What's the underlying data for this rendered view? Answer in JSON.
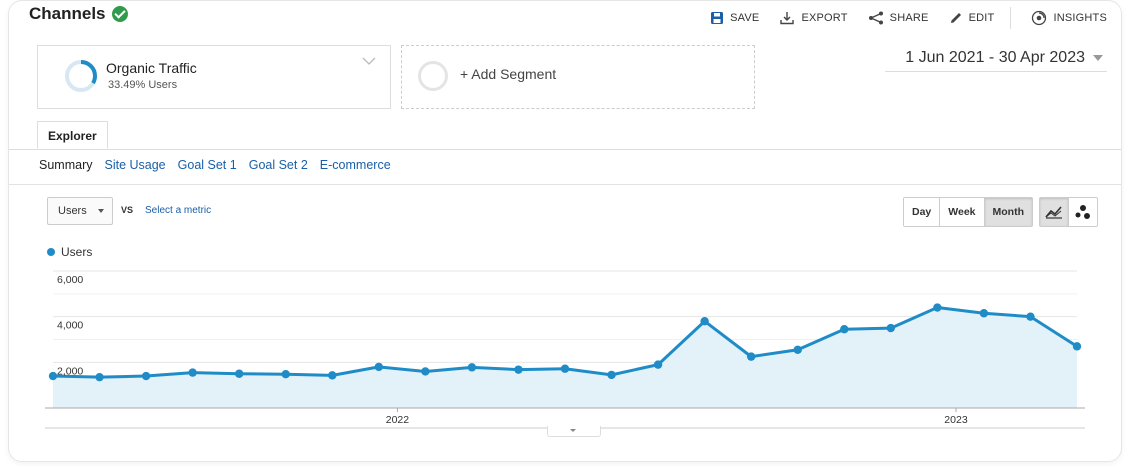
{
  "header": {
    "title": "Channels",
    "toolbar": {
      "save": "SAVE",
      "export": "EXPORT",
      "share": "SHARE",
      "edit": "EDIT",
      "insights": "INSIGHTS"
    }
  },
  "segments": {
    "primary": {
      "name": "Organic Traffic",
      "subtitle": "33.49% Users",
      "share": 0.3349
    },
    "add_label": "+ Add Segment"
  },
  "date_range": "1 Jun 2021 - 30 Apr 2023",
  "tabs": {
    "explorer": "Explorer"
  },
  "subnav": {
    "items": [
      "Summary",
      "Site Usage",
      "Goal Set 1",
      "Goal Set 2",
      "E-commerce"
    ],
    "active": "Summary"
  },
  "controls": {
    "metric": "Users",
    "vs": "VS",
    "select_metric": "Select a metric",
    "periods": [
      "Day",
      "Week",
      "Month"
    ],
    "active_period": "Month"
  },
  "colors": {
    "series": "#1f8cc7",
    "area": "#e3f1f9",
    "brand_check": "#2e9c4a",
    "link": "#1a5fa8"
  },
  "chart_data": {
    "type": "area",
    "legend_position": "top-left",
    "series": [
      {
        "name": "Users",
        "x": [
          "Jun 2021",
          "Jul 2021",
          "Aug 2021",
          "Sep 2021",
          "Oct 2021",
          "Nov 2021",
          "Dec 2021",
          "Jan 2022",
          "Feb 2022",
          "Mar 2022",
          "Apr 2022",
          "May 2022",
          "Jun 2022",
          "Jul 2022",
          "Aug 2022",
          "Sep 2022",
          "Oct 2022",
          "Nov 2022",
          "Dec 2022",
          "Jan 2023",
          "Feb 2023",
          "Mar 2023",
          "Apr 2023"
        ],
        "values": [
          1400,
          1350,
          1400,
          1550,
          1500,
          1480,
          1430,
          1800,
          1600,
          1780,
          1680,
          1720,
          1450,
          1900,
          3800,
          2250,
          2550,
          3450,
          3500,
          4400,
          4150,
          4000,
          2700
        ]
      }
    ],
    "yticks": [
      "6,000",
      "4,000",
      "2,000"
    ],
    "ytick_values": [
      6000,
      4000,
      2000
    ],
    "xticks": [
      "2022",
      "2023"
    ],
    "ylim": [
      0,
      6000
    ],
    "grid": true
  }
}
